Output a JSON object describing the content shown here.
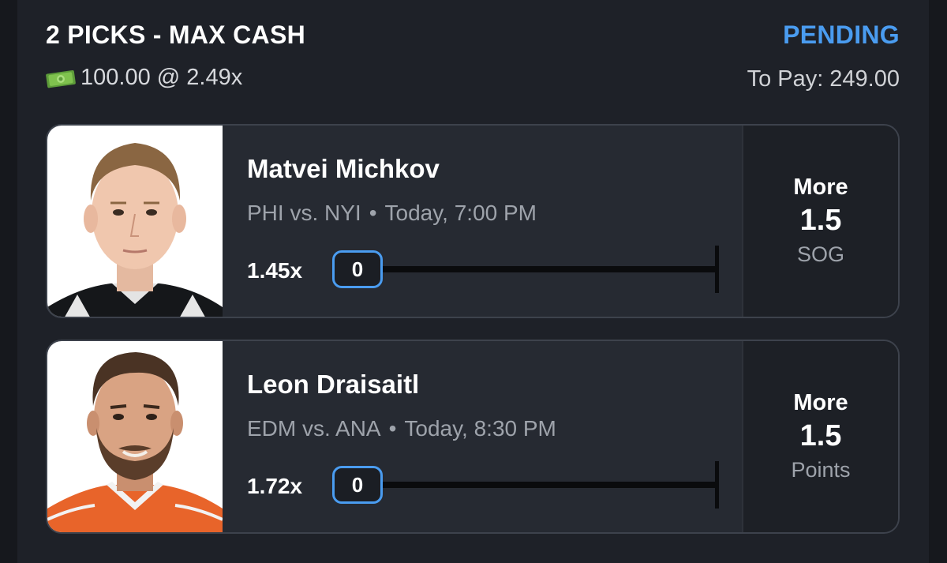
{
  "header": {
    "title": "2 PICKS - MAX CASH",
    "status": "PENDING",
    "stake_icon": "money-bill-icon",
    "stake": "100.00 @ 2.49x",
    "to_pay_label": "To Pay:",
    "to_pay_value": "249.00"
  },
  "colors": {
    "accent": "#4a9cf0",
    "background": "#1e2128",
    "card": "#262a32"
  },
  "picks": [
    {
      "player": "Matvei Michkov",
      "matchup": "PHI vs. NYI",
      "separator": "•",
      "time": "Today, 7:00 PM",
      "multiplier": "1.45x",
      "current": "0",
      "direction": "More",
      "line": "1.5",
      "stat": "SOG"
    },
    {
      "player": "Leon Draisaitl",
      "matchup": "EDM vs. ANA",
      "separator": "•",
      "time": "Today, 8:30 PM",
      "multiplier": "1.72x",
      "current": "0",
      "direction": "More",
      "line": "1.5",
      "stat": "Points"
    }
  ]
}
